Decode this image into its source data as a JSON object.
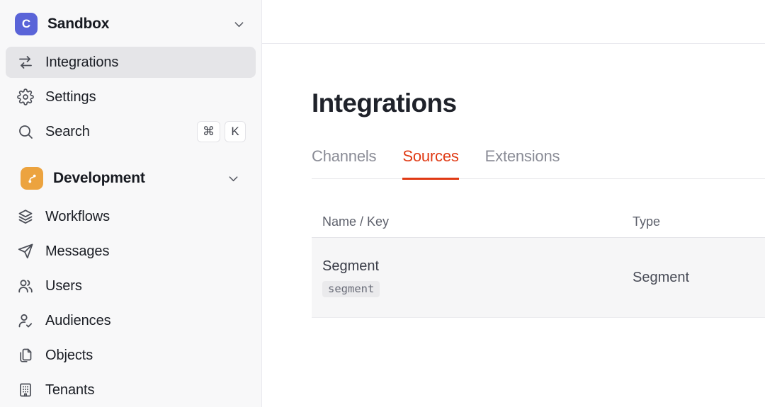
{
  "colors": {
    "accent": "#E03A14",
    "logo": "#5A64D8",
    "dev-icon": "#ECA33F",
    "sidebar-bg": "#F8F8F9",
    "active-bg": "#E5E5E8",
    "row-bg": "#F6F6F7"
  },
  "sidebar": {
    "workspace": {
      "name": "Sandbox",
      "logo_letter": "C"
    },
    "items": [
      {
        "label": "Integrations",
        "icon": "swap-arrows-icon",
        "active": true
      },
      {
        "label": "Settings",
        "icon": "gear-icon",
        "active": false
      },
      {
        "label": "Search",
        "icon": "search-icon",
        "active": false,
        "shortcut": [
          "⌘",
          "K"
        ]
      }
    ],
    "section": {
      "name": "Development",
      "icon": "branch-icon"
    },
    "section_items": [
      {
        "label": "Workflows",
        "icon": "layers-icon"
      },
      {
        "label": "Messages",
        "icon": "paper-plane-icon"
      },
      {
        "label": "Users",
        "icon": "users-icon"
      },
      {
        "label": "Audiences",
        "icon": "person-check-icon"
      },
      {
        "label": "Objects",
        "icon": "pages-icon"
      },
      {
        "label": "Tenants",
        "icon": "building-icon"
      }
    ]
  },
  "main": {
    "title": "Integrations",
    "tabs": [
      {
        "label": "Channels",
        "active": false
      },
      {
        "label": "Sources",
        "active": true
      },
      {
        "label": "Extensions",
        "active": false
      }
    ],
    "table": {
      "columns": [
        "Name / Key",
        "Type"
      ],
      "rows": [
        {
          "name": "Segment",
          "key": "segment",
          "type": "Segment"
        }
      ]
    }
  }
}
